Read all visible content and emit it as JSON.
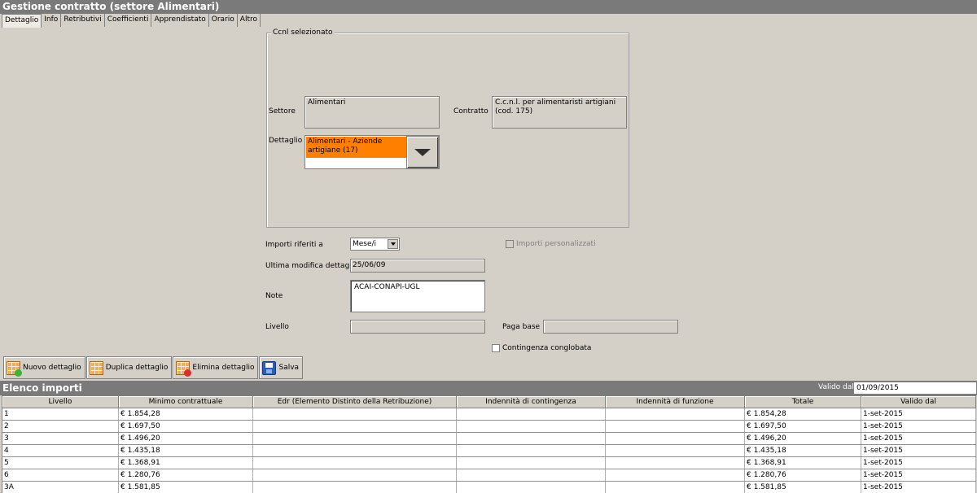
{
  "window": {
    "title": "Gestione contratto (settore Alimentari)"
  },
  "tabs": [
    "Dettaglio",
    "Info",
    "Retributivi",
    "Coefficienti",
    "Apprendistato",
    "Orario",
    "Altro"
  ],
  "ccnl": {
    "legend": "Ccnl selezionato",
    "settore_label": "Settore",
    "settore_value": "Alimentari",
    "contratto_label": "Contratto",
    "contratto_value": "C.c.n.l. per alimentaristi artigiani (cod. 175)",
    "dettaglio_label": "Dettaglio",
    "dettaglio_value": "Alimentari - Aziende artigiane (17)"
  },
  "form": {
    "importi_label": "Importi riferiti a",
    "importi_value": "Mese/i",
    "personalizzati_label": "Importi personalizzati",
    "ultima_label": "Ultima modifica dettaglio",
    "ultima_value": "25/06/09",
    "note_label": "Note",
    "note_value": "ACAI-CONAPI-UGL",
    "livello_label": "Livello",
    "livello_value": "",
    "paga_label": "Paga base",
    "paga_value": "",
    "contingenza_label": "Contingenza conglobata"
  },
  "toolbar": {
    "nuovo": "Nuovo dettaglio",
    "duplica": "Duplica dettaglio",
    "elimina": "Elimina dettaglio",
    "salva": "Salva"
  },
  "elenco": {
    "title": "Elenco importi",
    "valido_label": "Valido dal",
    "valido_value": "01/09/2015",
    "columns": [
      "Livello",
      "Minimo contrattuale",
      "Edr (Elemento Distinto della Retribuzione)",
      "Indennità di contingenza",
      "Indennità di funzione",
      "Totale",
      "Valido dal"
    ],
    "rows": [
      [
        "1",
        "€ 1.854,28",
        "",
        "",
        "",
        "€ 1.854,28",
        "1-set-2015"
      ],
      [
        "2",
        "€ 1.697,50",
        "",
        "",
        "",
        "€ 1.697,50",
        "1-set-2015"
      ],
      [
        "3",
        "€ 1.496,20",
        "",
        "",
        "",
        "€ 1.496,20",
        "1-set-2015"
      ],
      [
        "4",
        "€ 1.435,18",
        "",
        "",
        "",
        "€ 1.435,18",
        "1-set-2015"
      ],
      [
        "5",
        "€ 1.368,91",
        "",
        "",
        "",
        "€ 1.368,91",
        "1-set-2015"
      ],
      [
        "6",
        "€ 1.280,76",
        "",
        "",
        "",
        "€ 1.280,76",
        "1-set-2015"
      ],
      [
        "3A",
        "€ 1.581,85",
        "",
        "",
        "",
        "€ 1.581,85",
        "1-set-2015"
      ]
    ]
  }
}
